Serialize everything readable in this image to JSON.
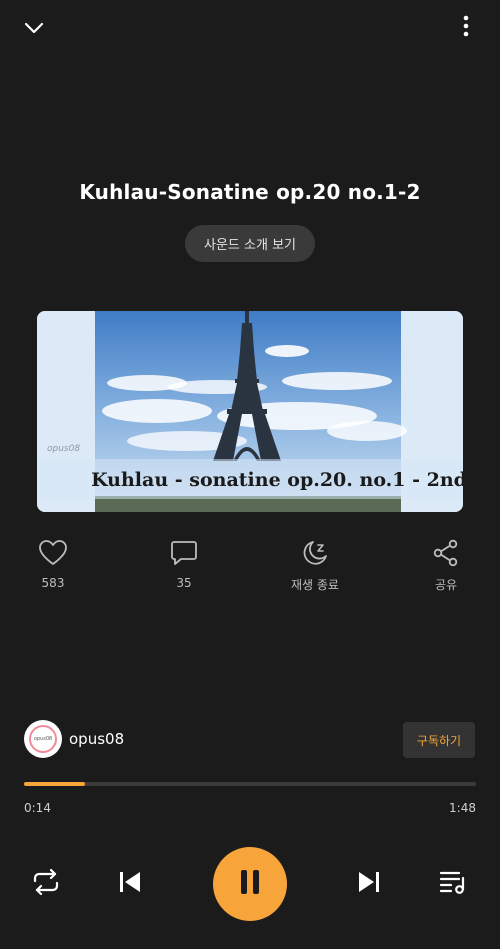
{
  "header": {
    "collapse_icon": "chevron-down-icon",
    "menu_icon": "more-vertical-icon"
  },
  "track": {
    "title": "Kuhlau-Sonatine op.20 no.1-2",
    "intro_button": "사운드 소개 보기",
    "cover_text": "Kuhlau - sonatine op.20. no.1 - 2nd",
    "cover_watermark": "opus08"
  },
  "actions": [
    {
      "icon": "heart-icon",
      "label": "583"
    },
    {
      "icon": "comment-icon",
      "label": "35"
    },
    {
      "icon": "sleep-timer-icon",
      "label": "재생 종료"
    },
    {
      "icon": "share-icon",
      "label": "공유"
    }
  ],
  "artist": {
    "avatar_text": "opus08",
    "name": "opus08",
    "subscribe_label": "구독하기"
  },
  "playback": {
    "progress": 0.135,
    "elapsed": "0:14",
    "duration": "1:48",
    "state": "playing"
  },
  "colors": {
    "background": "#1b1b1b",
    "accent": "#f7a53b"
  }
}
